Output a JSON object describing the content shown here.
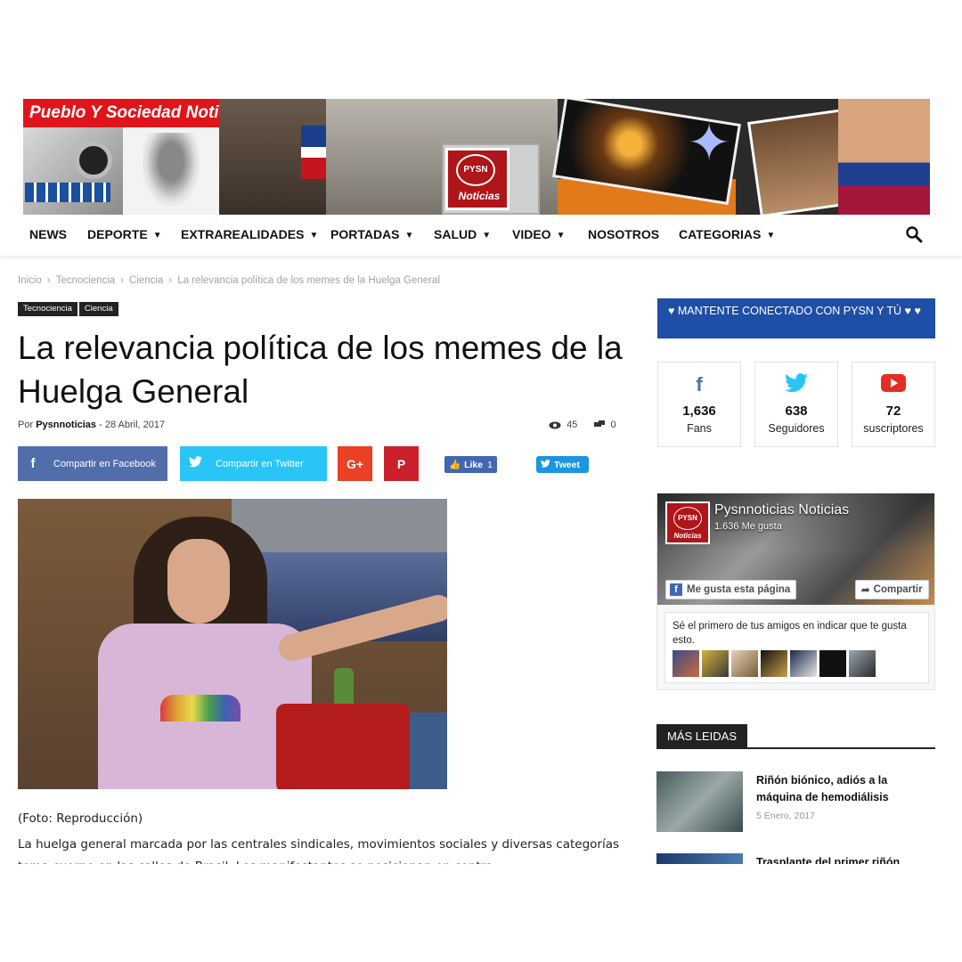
{
  "banner": {
    "site_title": "Pueblo Y Sociedad Noticias",
    "logo_circle": "PYSN",
    "logo_word": "Noticias"
  },
  "nav": {
    "items": [
      {
        "label": "NEWS",
        "has_dropdown": false
      },
      {
        "label": "DEPORTE",
        "has_dropdown": true
      },
      {
        "label": "EXTRAREALIDADES",
        "has_dropdown": true
      },
      {
        "label": "PORTADAS",
        "has_dropdown": true
      },
      {
        "label": "SALUD",
        "has_dropdown": true
      },
      {
        "label": "VIDEO",
        "has_dropdown": true
      },
      {
        "label": "NOSOTROS",
        "has_dropdown": false
      },
      {
        "label": "CATEGORIAS",
        "has_dropdown": true
      }
    ],
    "search_icon": "search-icon",
    "dropdown_icon": "⌄"
  },
  "breadcrumb": {
    "items": [
      "Inicio",
      "Tecnociencia",
      "Ciencia",
      "La relevancia política de los memes de la Huelga General"
    ],
    "separator": "›"
  },
  "article": {
    "tags": [
      "Tecnociencia",
      "Ciencia"
    ],
    "title": "La relevancia política de los memes de la Huelga General",
    "by_label": "Por",
    "author": "Pysnnoticias",
    "date_separator": "-",
    "date": "28 Abril, 2017",
    "views": "45",
    "comments": "0",
    "share": {
      "facebook": "Compartir en Facebook",
      "twitter": "Compartir en Twitter",
      "googleplus": "G+",
      "pinterest": "P",
      "like_label": "Like",
      "like_count": "1",
      "tweet_label": "Tweet"
    },
    "caption": "(Foto: Reproducción)",
    "body": "La huelga general marcada por las centrales sindicales, movimientos sociales y diversas categorías toma cuerpo en las calles de Brasil. Los manifestantes se posicionan en contra"
  },
  "sidebar": {
    "connect_title": "♥ MANTENTE CONECTADO CON PYSN Y TÚ ♥ ♥",
    "social": [
      {
        "icon": "facebook-icon",
        "glyph": "f",
        "count": "1,636",
        "label": "Fans",
        "color": "#516eab"
      },
      {
        "icon": "twitter-icon",
        "glyph": "🐦",
        "count": "638",
        "label": "Seguidores",
        "color": "#29c5f6"
      },
      {
        "icon": "youtube-icon",
        "glyph": "▶",
        "count": "72",
        "label": "suscriptores",
        "color": "#e52d27"
      }
    ],
    "fb_widget": {
      "page_name": "Pysnnoticias Noticias",
      "page_likes": "1.636 Me gusta",
      "like_page": "Me gusta esta página",
      "share": "Compartir",
      "friends_text": "Sé el primero de tus amigos en indicar que te gusta esto."
    },
    "mas_leidas": {
      "title": "MÁS LEIDAS",
      "items": [
        {
          "title": "Riñón biónico, adiós a la máquina de hemodiálisis",
          "date": "5 Enero, 2017"
        },
        {
          "title": "Trasplante del primer riñón",
          "date": ""
        }
      ]
    }
  },
  "colors": {
    "facebook": "#516eab",
    "twitter": "#29c5f6",
    "googleplus": "#eb4026",
    "pinterest": "#ca212a",
    "connect_bar": "#1e4ea5",
    "brand_red": "#e0151b"
  }
}
